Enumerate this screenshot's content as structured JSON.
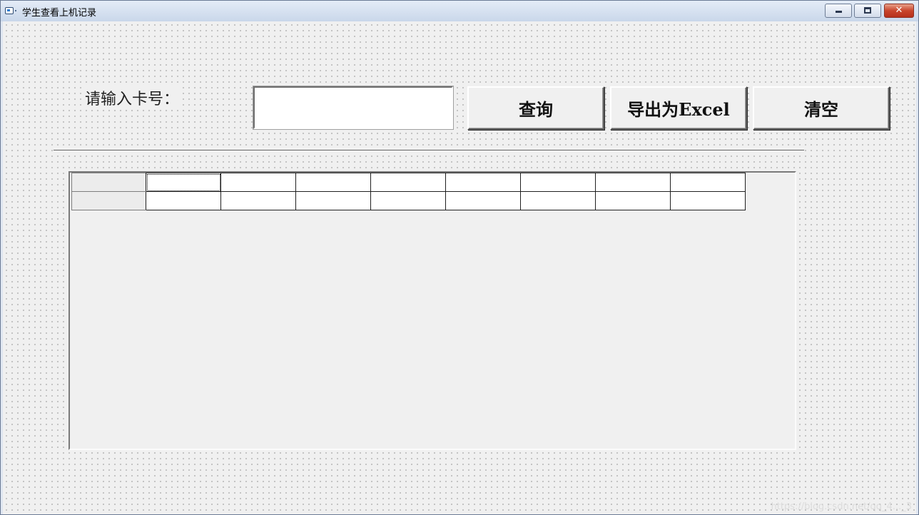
{
  "window": {
    "title": "学生查看上机记录",
    "icon": "app-form-icon",
    "controls": [
      "minimize",
      "maximize",
      "close"
    ],
    "close_glyph": "✕"
  },
  "form": {
    "card_label": "请输入卡号：",
    "card_input_value": "",
    "buttons": {
      "query": "查询",
      "export": "导出为Excel",
      "clear": "清空"
    }
  },
  "grid": {
    "rows": [
      [
        "",
        "",
        "",
        "",
        "",
        "",
        "",
        "",
        ""
      ],
      [
        "",
        "",
        "",
        "",
        "",
        "",
        "",
        "",
        ""
      ]
    ]
  },
  "watermark": "https://blog.csdn.net/qq_4..._3"
}
